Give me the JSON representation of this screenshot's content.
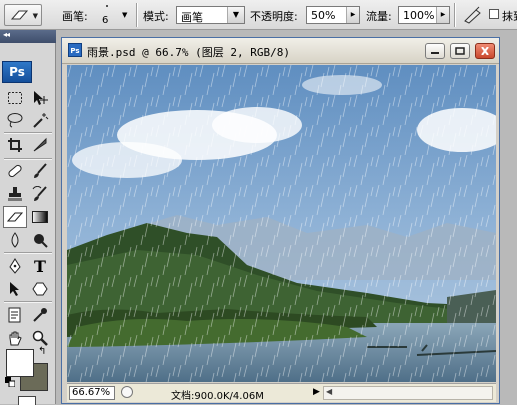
{
  "options_bar": {
    "brush_label": "画笔:",
    "brush_size": "6",
    "mode_label": "模式:",
    "mode_value": "画笔",
    "opacity_label": "不透明度:",
    "opacity_value": "50%",
    "flow_label": "流量:",
    "flow_value": "100%",
    "erase_history_label": "抹到"
  },
  "toolbox": {
    "collapse_label": "◂◂",
    "logo": "Ps",
    "text_tool_glyph": "T"
  },
  "document": {
    "title": "雨景.psd @ 66.7% (图层 2, RGB/8)",
    "zoom": "66.67%",
    "doc_info": "文档:900.0K/4.06M"
  },
  "colors": {
    "foreground": "#ffffff",
    "background": "#6b6b58",
    "window_border": "#4a6fa5"
  }
}
